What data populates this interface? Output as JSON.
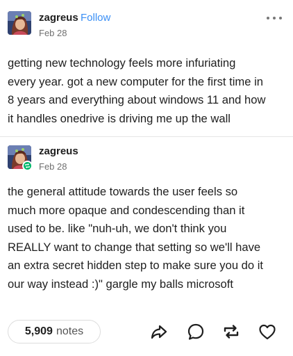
{
  "post": {
    "author": "zagreus",
    "follow_label": "Follow",
    "date": "Feb 28",
    "text": [
      "getting new technology feels more infuriating",
      "every year. got a new computer for the first time in",
      "8 years and everything about windows 11 and how",
      "it handles onedrive is driving me up the wall"
    ]
  },
  "reblog": {
    "author": "zagreus",
    "date": "Feb 28",
    "text": [
      "the general attitude towards the user feels so",
      "much more opaque and condescending than it",
      "used to be. like \"nuh-uh, we don't think you",
      "REALLY want to change that setting so we'll have",
      "an extra secret hidden step to make sure you do it",
      "our way instead :)\" gargle my balls microsoft"
    ]
  },
  "footer": {
    "notes_count": "5,909",
    "notes_label": "notes"
  },
  "colors": {
    "follow": "#3a8ff5",
    "reblog_badge": "#00b86b"
  },
  "icons": [
    "more-icon",
    "share-icon",
    "reply-icon",
    "reblog-icon",
    "like-icon",
    "reblog-badge-icon"
  ]
}
